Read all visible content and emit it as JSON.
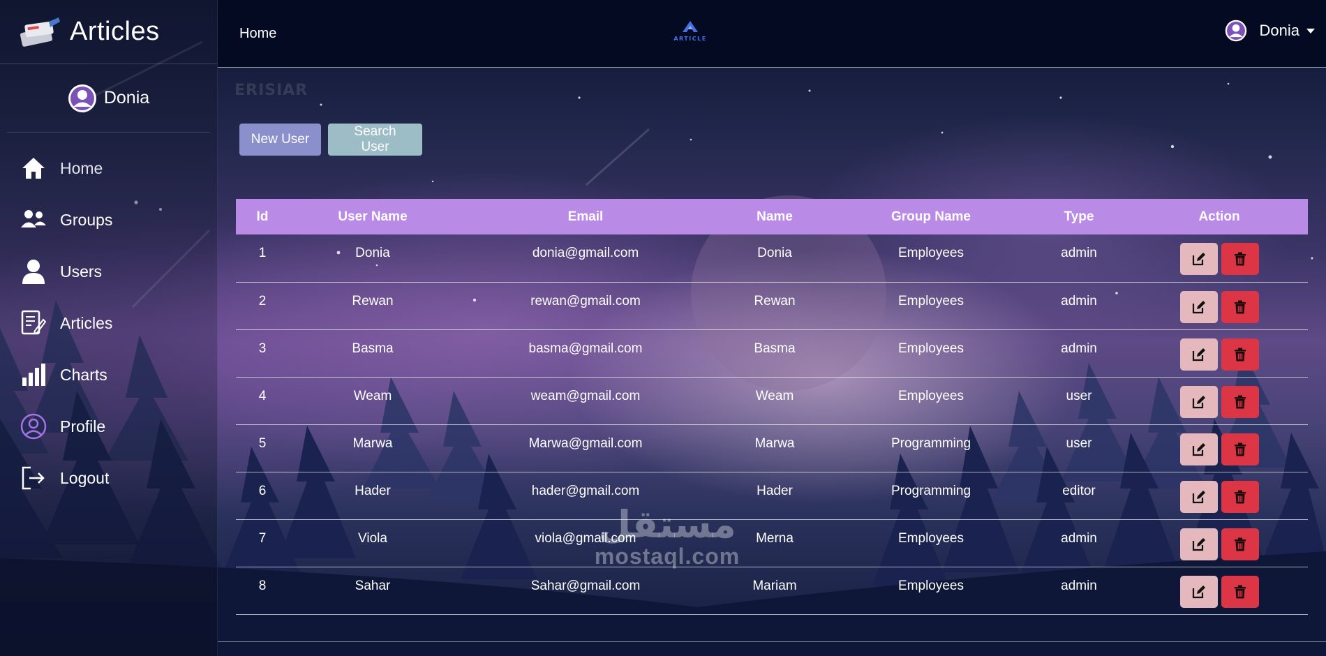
{
  "sidebar": {
    "brand_title": "Articles",
    "user_name": "Donia",
    "items": [
      {
        "label": "Home",
        "icon": "home-icon"
      },
      {
        "label": "Groups",
        "icon": "groups-icon"
      },
      {
        "label": "Users",
        "icon": "user-icon"
      },
      {
        "label": "Articles",
        "icon": "articles-icon"
      },
      {
        "label": "Charts",
        "icon": "chart-icon"
      },
      {
        "label": "Profile",
        "icon": "profile-icon"
      },
      {
        "label": "Logout",
        "icon": "logout-icon"
      }
    ]
  },
  "topbar": {
    "home_label": "Home",
    "logo_text": "ARTICLE",
    "user_name": "Donia"
  },
  "main": {
    "watermark": "ERISIAR",
    "new_user_label": "New User",
    "search_user_label": "Search User",
    "columns": [
      "Id",
      "User Name",
      "Email",
      "Name",
      "Group Name",
      "Type",
      "Action"
    ],
    "rows": [
      {
        "id": "1",
        "username": "Donia",
        "email": "donia@gmail.com",
        "name": "Donia",
        "group": "Employees",
        "type": "admin"
      },
      {
        "id": "2",
        "username": "Rewan",
        "email": "rewan@gmail.com",
        "name": "Rewan",
        "group": "Employees",
        "type": "admin"
      },
      {
        "id": "3",
        "username": "Basma",
        "email": "basma@gmail.com",
        "name": "Basma",
        "group": "Employees",
        "type": "admin"
      },
      {
        "id": "4",
        "username": "Weam",
        "email": "weam@gmail.com",
        "name": "Weam",
        "group": "Employees",
        "type": "user"
      },
      {
        "id": "5",
        "username": "Marwa",
        "email": "Marwa@gmail.com",
        "name": "Marwa",
        "group": "Programming",
        "type": "user"
      },
      {
        "id": "6",
        "username": "Hader",
        "email": "hader@gmail.com",
        "name": "Hader",
        "group": "Programming",
        "type": "editor"
      },
      {
        "id": "7",
        "username": "Viola",
        "email": "viola@gmail.com",
        "name": "Merna",
        "group": "Employees",
        "type": "admin"
      },
      {
        "id": "8",
        "username": "Sahar",
        "email": "Sahar@gmail.com",
        "name": "Mariam",
        "group": "Employees",
        "type": "admin"
      }
    ]
  },
  "watermark_site": {
    "mark": "مستقل",
    "text": "mostaql.com"
  },
  "colors": {
    "header_row": "#b98be6",
    "new_user_btn": "#8b8fcb",
    "search_user_btn": "#9cbcc6",
    "edit_btn": "#e4b8bc",
    "delete_btn": "#dc3545",
    "topbar": "#030a22"
  }
}
